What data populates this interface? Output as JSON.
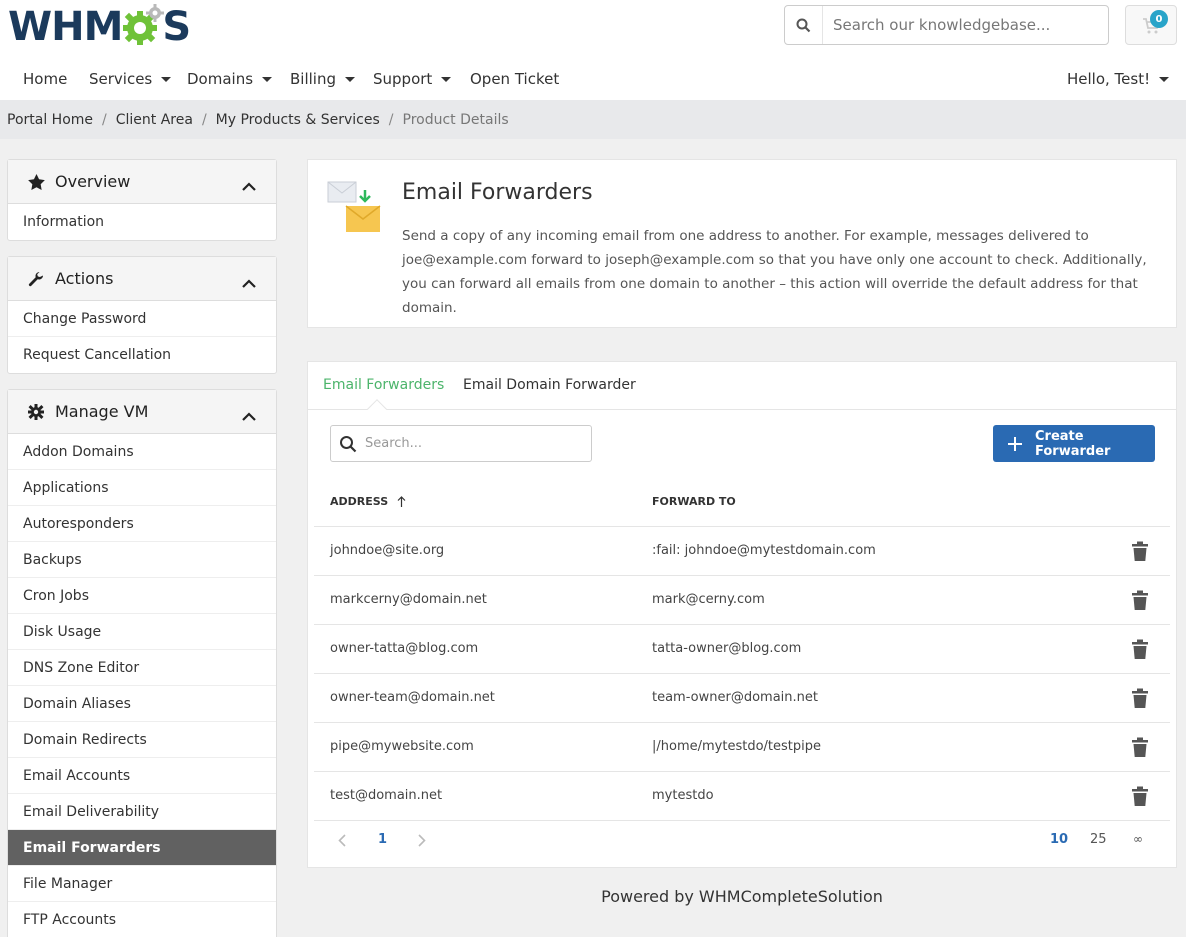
{
  "brand": {
    "logo_text_left": "WHM",
    "logo_text_right": "S"
  },
  "header": {
    "search_placeholder": "Search our knowledgebase...",
    "cart_count": "0",
    "nav": {
      "home": "Home",
      "services": "Services",
      "domains": "Domains",
      "billing": "Billing",
      "support": "Support",
      "open_ticket": "Open Ticket",
      "user": "Hello, Test!"
    }
  },
  "breadcrumb": [
    "Portal Home",
    "Client Area",
    "My Products & Services",
    "Product Details"
  ],
  "sidebar": {
    "overview": {
      "title": "Overview",
      "items": [
        "Information"
      ]
    },
    "actions": {
      "title": "Actions",
      "items": [
        "Change Password",
        "Request Cancellation"
      ]
    },
    "manage": {
      "title": "Manage VM",
      "items": [
        "Addon Domains",
        "Applications",
        "Autoresponders",
        "Backups",
        "Cron Jobs",
        "Disk Usage",
        "DNS Zone Editor",
        "Domain Aliases",
        "Domain Redirects",
        "Email Accounts",
        "Email Deliverability",
        "Email Forwarders",
        "File Manager",
        "FTP Accounts"
      ],
      "active": "Email Forwarders"
    }
  },
  "intro": {
    "title": "Email Forwarders",
    "description": "Send a copy of any incoming email from one address to another. For example, messages delivered to joe@example.com forward to joseph@example.com so that you have only one account to check. Additionally, you can forward all emails from one domain to another – this action will override the default address for that domain."
  },
  "tabs": {
    "forwarders": "Email Forwarders",
    "domain_forwarder": "Email Domain Forwarder"
  },
  "table": {
    "search_placeholder": "Search...",
    "create_button": "Create Forwarder",
    "col_address": "ADDRESS",
    "col_forward": "FORWARD TO",
    "rows": [
      {
        "address": "johndoe@site.org",
        "forward": ":fail: johndoe@mytestdomain.com"
      },
      {
        "address": "markcerny@domain.net",
        "forward": "mark@cerny.com"
      },
      {
        "address": "owner-tatta@blog.com",
        "forward": "tatta-owner@blog.com"
      },
      {
        "address": "owner-team@domain.net",
        "forward": "team-owner@domain.net"
      },
      {
        "address": "pipe@mywebsite.com",
        "forward": "|/home/mytestdo/testpipe"
      },
      {
        "address": "test@domain.net",
        "forward": "mytestdo"
      }
    ]
  },
  "pager": {
    "page": "1",
    "size_10": "10",
    "size_25": "25",
    "size_all": "∞"
  },
  "footer": "Powered by WHMCompleteSolution",
  "colors": {
    "accent": "#2a6ab3",
    "tab_active": "#4cb46b",
    "sidebar_active": "#616161",
    "logo_blue": "#1b3a5c",
    "logo_green": "#6fc238"
  }
}
